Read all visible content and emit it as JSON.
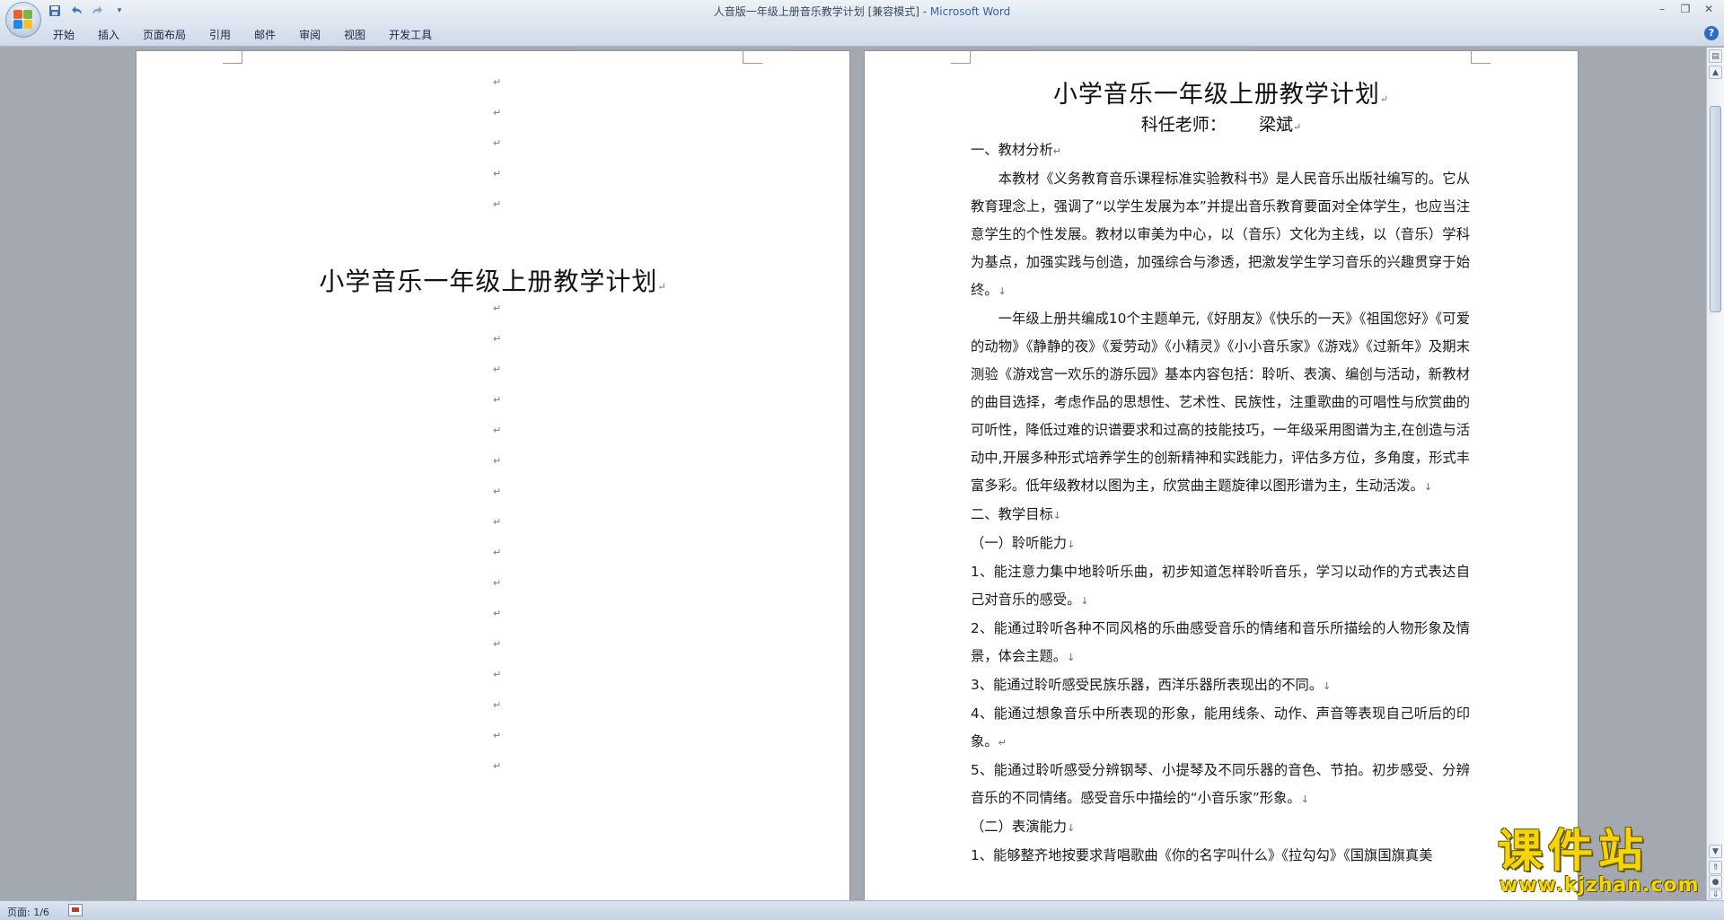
{
  "window": {
    "title": "人音版一年级上册音乐教学计划 [兼容模式] - ",
    "app_name": "Microsoft Word"
  },
  "quick_access": {
    "icons": [
      "save-icon",
      "undo-icon",
      "redo-icon",
      "customize-icon"
    ]
  },
  "ribbon": {
    "tabs": [
      "开始",
      "插入",
      "页面布局",
      "引用",
      "邮件",
      "审阅",
      "视图",
      "开发工具"
    ]
  },
  "page1": {
    "title": "小学音乐一年级上册教学计划",
    "mark": "↵"
  },
  "page2": {
    "title": "小学音乐一年级上册教学计划",
    "subtitle": "科任老师：      梁斌",
    "paragraphs": [
      {
        "text": "一、教材分析",
        "indent": false,
        "mark": "↵"
      },
      {
        "text": "本教材《义务教育音乐课程标准实验教科书》是人民音乐出版社编写的。它从教育理念上，强调了“以学生发展为本”并提出音乐教育要面对全体学生，也应当注意学生的个性发展。教材以审美为中心，以（音乐）文化为主线，以（音乐）学科为基点，加强实践与创造，加强综合与渗透，把激发学生学习音乐的兴趣贯穿于始终。",
        "indent": true,
        "mark": "↓"
      },
      {
        "text": "一年级上册共编成10个主题单元,《好朋友》《快乐的一天》《祖国您好》《可爱的动物》《静静的夜》《爱劳动》《小精灵》《小小音乐家》《游戏》《过新年》及期末测验《游戏宫一欢乐的游乐园》基本内容包括：聆听、表演、编创与活动，新教材的曲目选择，考虑作品的思想性、艺术性、民族性，注重歌曲的可唱性与欣赏曲的可听性，降低过难的识谱要求和过高的技能技巧，一年级采用图谱为主,在创造与活动中,开展多种形式培养学生的创新精神和实践能力，评估多方位，多角度，形式丰富多彩。低年级教材以图为主，欣赏曲主题旋律以图形谱为主，生动活泼。",
        "indent": true,
        "mark": "↓"
      },
      {
        "text": "二、教学目标",
        "indent": false,
        "mark": "↓"
      },
      {
        "text": "（一）聆听能力",
        "indent": false,
        "mark": "↓"
      },
      {
        "text": "1、能注意力集中地聆听乐曲，初步知道怎样聆听音乐，学习以动作的方式表达自己对音乐的感受。",
        "indent": false,
        "mark": "↓"
      },
      {
        "text": "2、能通过聆听各种不同风格的乐曲感受音乐的情绪和音乐所描绘的人物形象及情景，体会主题。",
        "indent": false,
        "mark": "↓"
      },
      {
        "text": "3、能通过聆听感受民族乐器，西洋乐器所表现出的不同。",
        "indent": false,
        "mark": "↓"
      },
      {
        "text": "4、能通过想象音乐中所表现的形象，能用线条、动作、声音等表现自己听后的印象。",
        "indent": false,
        "mark": "↵"
      },
      {
        "text": "5、能通过聆听感受分辨钢琴、小提琴及不同乐器的音色、节拍。初步感受、分辨音乐的不同情绪。感受音乐中描绘的“小音乐家”形象。",
        "indent": false,
        "mark": "↓"
      },
      {
        "text": "（二）表演能力",
        "indent": false,
        "mark": "↓"
      },
      {
        "text": "1、能够整齐地按要求背唱歌曲《你的名字叫什么》《拉勾勾》《国旗国旗真美",
        "indent": false,
        "mark": ""
      }
    ]
  },
  "status": {
    "page_info": "页面: 1/6"
  },
  "watermark": {
    "main": "课件站",
    "url": "www.kjzhan.com"
  }
}
